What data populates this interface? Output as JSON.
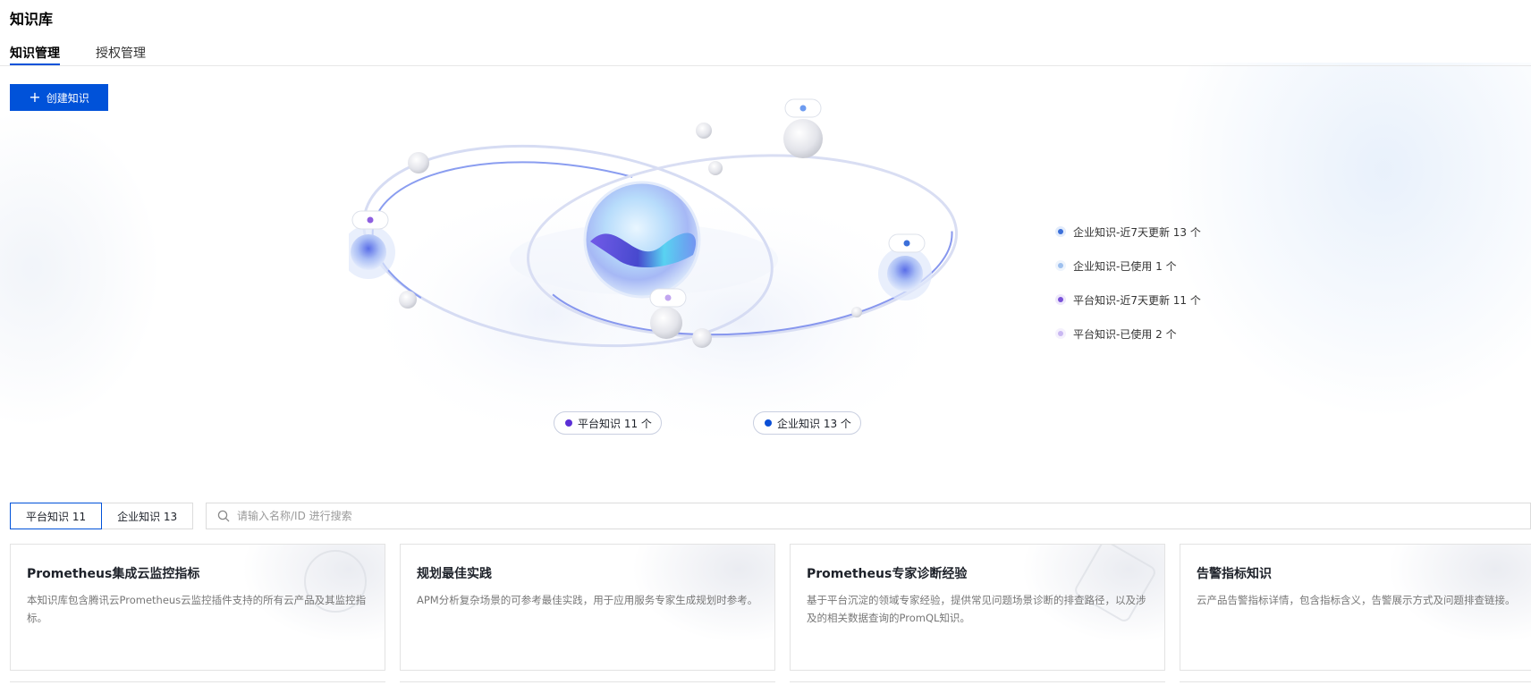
{
  "page": {
    "title": "知识库"
  },
  "tabs": [
    {
      "label": "知识管理",
      "active": true
    },
    {
      "label": "授权管理",
      "active": false
    }
  ],
  "create_button": {
    "label": "创建知识",
    "icon": "plus-icon"
  },
  "legend": [
    {
      "label": "企业知识-近7天更新 13 个",
      "color": "#3b6fd9"
    },
    {
      "label": "企业知识-已使用 1 个",
      "color": "#9ec0ee"
    },
    {
      "label": "平台知识-近7天更新 11 个",
      "color": "#7a52d9"
    },
    {
      "label": "平台知识-已使用 2 个",
      "color": "#c9b8f2"
    }
  ],
  "pills": {
    "platform": {
      "label": "平台知识 11 个",
      "color": "#5b2fd6"
    },
    "enterprise": {
      "label": "企业知识 13 个",
      "color": "#0b4fd6"
    }
  },
  "filter": {
    "segments": [
      {
        "label": "平台知识 11",
        "active": true
      },
      {
        "label": "企业知识 13",
        "active": false
      }
    ],
    "search_placeholder": "请输入名称/ID 进行搜索",
    "search_icon": "search-icon"
  },
  "cards": [
    {
      "title": "Prometheus集成云监控指标",
      "desc": "本知识库包含腾讯云Prometheus云监控插件支持的所有云产品及其监控指标。"
    },
    {
      "title": "规划最佳实践",
      "desc": "APM分析复杂场景的可参考最佳实践，用于应用服务专家生成规划时参考。"
    },
    {
      "title": "Prometheus专家诊断经验",
      "desc": "基于平台沉淀的领域专家经验，提供常见问题场景诊断的排查路径，以及涉及的相关数据查询的PromQL知识。"
    },
    {
      "title": "告警指标知识",
      "desc": "云产品告警指标详情，包含指标含义，告警展示方式及问题排查链接。"
    }
  ],
  "colors": {
    "primary": "#0052d9",
    "border": "#dcdcdc"
  }
}
